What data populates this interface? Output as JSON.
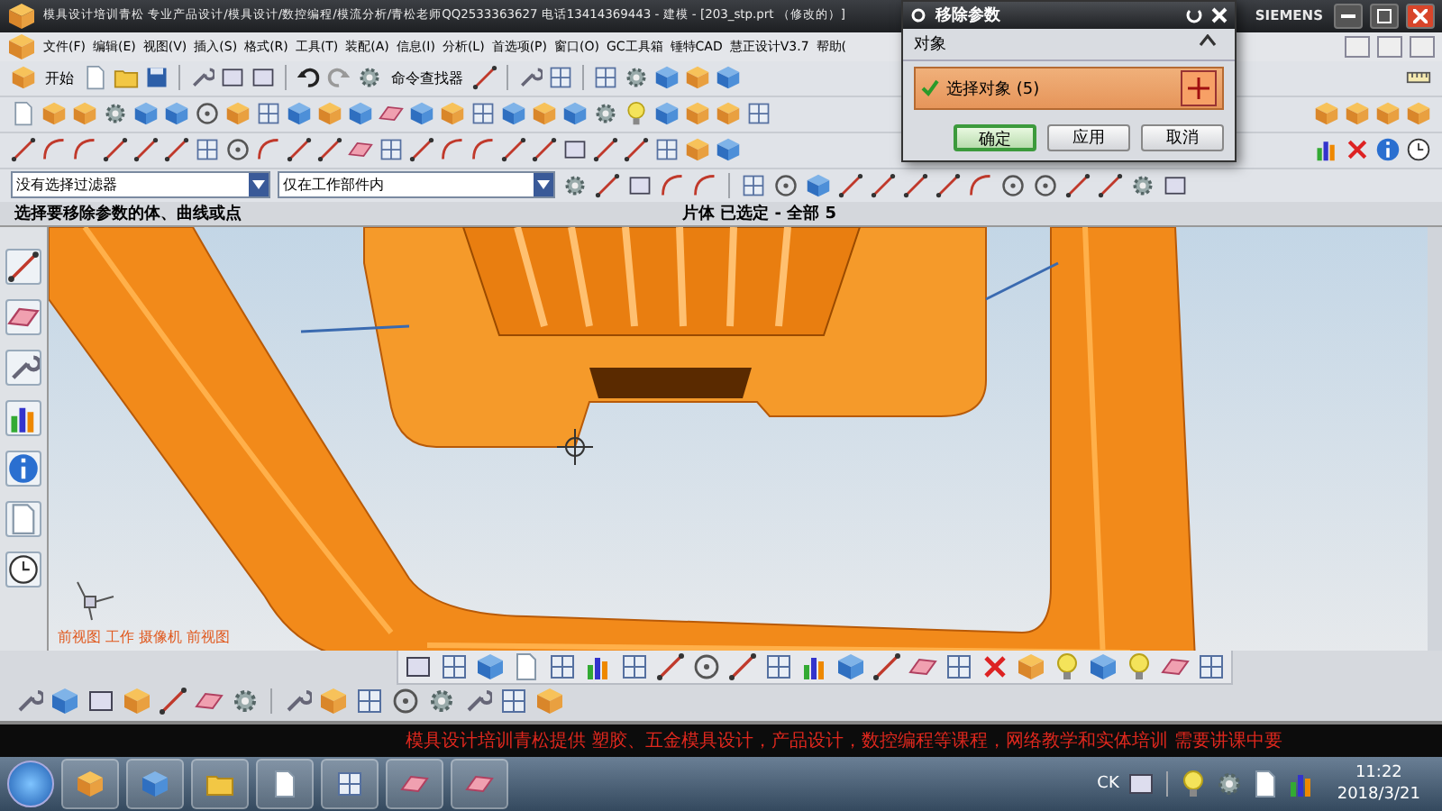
{
  "window": {
    "title": "模具设计培训青松 专业产品设计/模具设计/数控编程/模流分析/青松老师QQ2533363627 电话13414369443 - 建模 - [203_stp.prt （修改的）]",
    "brand": "SIEMENS"
  },
  "menu": [
    "文件(F)",
    "编辑(E)",
    "视图(V)",
    "插入(S)",
    "格式(R)",
    "工具(T)",
    "装配(A)",
    "信息(I)",
    "分析(L)",
    "首选项(P)",
    "窗口(O)",
    "GC工具箱",
    "锤特CAD",
    "慧正设计V3.7",
    "帮助("
  ],
  "toolbar": {
    "start_button": "开始",
    "command_finder": "命令查找器"
  },
  "selection_bar": {
    "filter": "没有选择过滤器",
    "scope": "仅在工作部件内"
  },
  "cue_line": "选择要移除参数的体、曲线或点",
  "status_line": "片体 已选定 - 全部 5",
  "viewport": {
    "view_label": "前视图 工作 摄像机 前视图"
  },
  "dialog": {
    "title": "移除参数",
    "section": {
      "title": "对象",
      "expanded": true,
      "rows": [
        {
          "label": "选择对象 (5)",
          "complete": true
        }
      ]
    },
    "buttons": [
      {
        "label": "确定",
        "default": true
      },
      {
        "label": "应用",
        "default": false
      },
      {
        "label": "取消",
        "default": false
      }
    ]
  },
  "banner": "模具设计培训青松提供  塑胶、五金模具设计，产品设计，数控编程等课程，网络教学和实体培训  需要讲课中要",
  "taskbar": {
    "tray_text": "CK",
    "time": "11:22",
    "date": "2018/3/21"
  }
}
